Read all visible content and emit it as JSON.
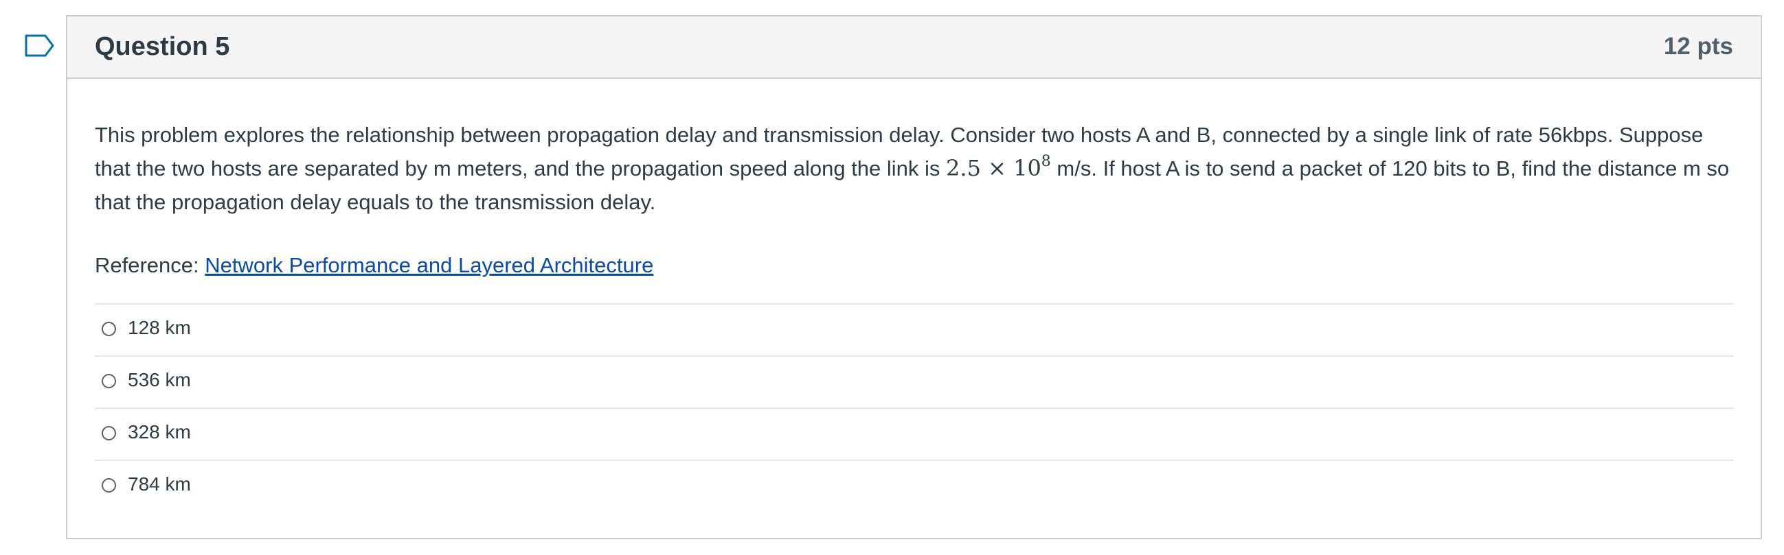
{
  "question": {
    "title": "Question 5",
    "points": "12 pts",
    "text_before_math": "This problem explores the relationship between propagation delay and transmission delay. Consider two hosts A and B, connected by a single link of rate 56kbps. Suppose that the two hosts are separated by m meters, and the propagation speed along the link is ",
    "math_base": "2.5 × 10",
    "math_exponent": "8",
    "text_after_math": " m/s. If host A is to send a packet of 120 bits to B, find the distance m so that the propagation delay equals to the transmission delay.",
    "reference_label": "Reference: ",
    "reference_link": "Network Performance and Layered Architecture"
  },
  "answers": [
    {
      "label": "128 km"
    },
    {
      "label": "536 km"
    },
    {
      "label": "328 km"
    },
    {
      "label": "784 km"
    }
  ],
  "colors": {
    "link": "#0b4aa8",
    "header_bg": "#f5f5f5",
    "border": "#c7cdd1",
    "flag": "#0770a3"
  },
  "icons": {
    "flag": "bookmark-flag-icon"
  }
}
